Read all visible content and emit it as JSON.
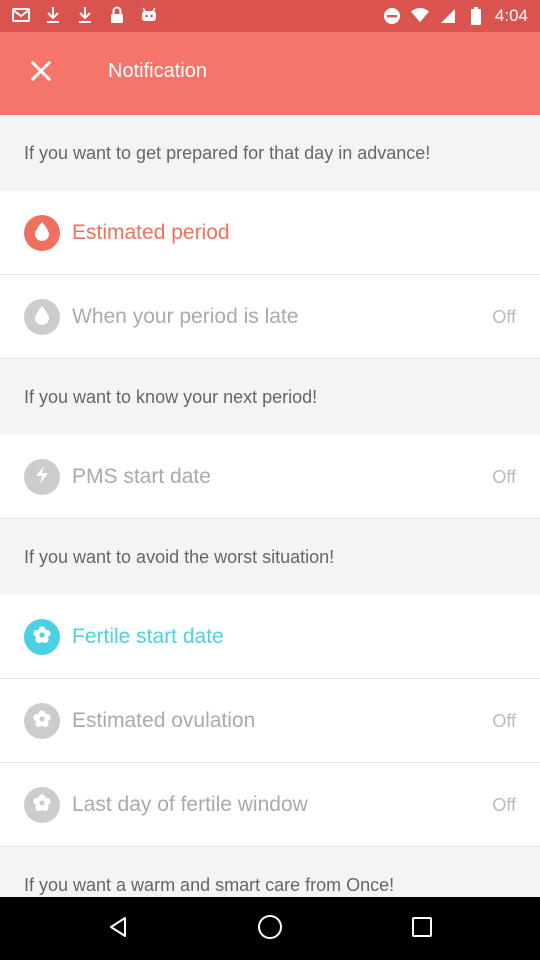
{
  "status_bar": {
    "time": "4:04",
    "left_icons": [
      "mail-icon",
      "download-icon",
      "download-icon",
      "lock-icon",
      "robot-icon"
    ]
  },
  "header": {
    "title": "Notification"
  },
  "sections": [
    {
      "header": "If you want to get prepared for that day in advance!",
      "rows": [
        {
          "label": "Estimated period",
          "status": "",
          "icon": "drop-icon",
          "color": "#f0705f",
          "active": true
        },
        {
          "label": "When your period is late",
          "status": "Off",
          "icon": "drop-icon",
          "color": "#cccccc",
          "active": false
        }
      ]
    },
    {
      "header": "If you want to know your next period!",
      "rows": [
        {
          "label": "PMS start date",
          "status": "Off",
          "icon": "lightning-icon",
          "color": "#cccccc",
          "active": false
        }
      ]
    },
    {
      "header": "If you want to avoid the worst situation!",
      "rows": [
        {
          "label": "Fertile start date",
          "status": "",
          "icon": "flower-icon",
          "color": "#4dd0e1",
          "active": true
        },
        {
          "label": "Estimated ovulation",
          "status": "Off",
          "icon": "flower-icon",
          "color": "#cccccc",
          "active": false
        },
        {
          "label": "Last day of fertile window",
          "status": "Off",
          "icon": "flower-icon",
          "color": "#cccccc",
          "active": false
        }
      ]
    },
    {
      "header": "If you want a warm and smart care from Once!",
      "rows": []
    }
  ]
}
